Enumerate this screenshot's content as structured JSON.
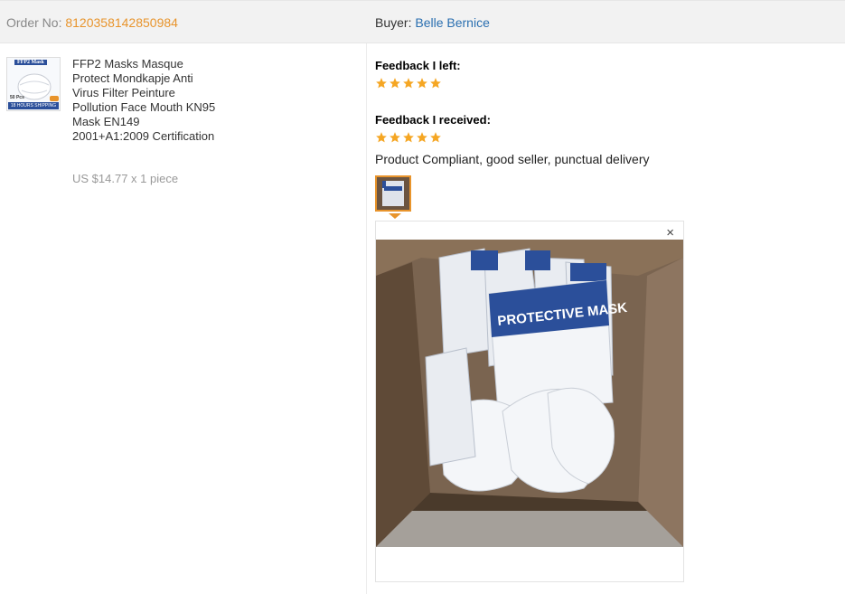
{
  "header": {
    "order_label": "Order No:",
    "order_number": "8120358142850984",
    "buyer_label": "Buyer:",
    "buyer_name": "Belle Bernice"
  },
  "product": {
    "thumb_brand": "FFP2 Mask",
    "thumb_pcs": "50 Pcs",
    "thumb_shipping": "18 HOURS SHIPPING",
    "title": "FFP2 Masks Masque Protect Mondkapje Anti Virus Filter Peinture Pollution Face Mouth KN95 Mask EN149 2001+A1:2009 Certification",
    "price": "US $14.77 x 1 piece"
  },
  "feedback": {
    "left_label": "Feedback I left:",
    "left_rating": 5,
    "received_label": "Feedback I received:",
    "received_rating": 5,
    "comment": "Product Compliant, good seller, punctual delivery",
    "photo_text": "PROTECTIVE MASK",
    "close_symbol": "×"
  },
  "colors": {
    "accent": "#e8942c",
    "link": "#2a6fb0",
    "star": "#f5a623"
  }
}
